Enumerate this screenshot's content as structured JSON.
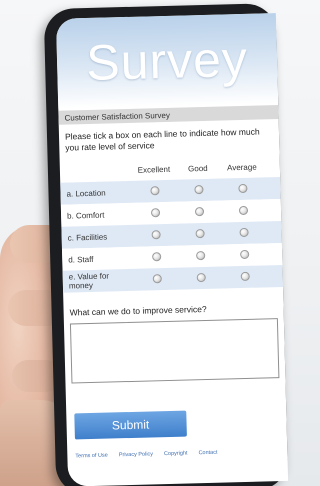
{
  "hero": {
    "title": "Survey"
  },
  "form": {
    "bar_title": "Customer Satisfaction Survey",
    "instruction": "Please tick a box on each line to indicate how much you rate level of service",
    "columns": [
      "Excellent",
      "Good",
      "Average"
    ],
    "rows": [
      {
        "label": "a. Location"
      },
      {
        "label": "b. Comfort"
      },
      {
        "label": "c. Facilities"
      },
      {
        "label": "d. Staff"
      },
      {
        "label": "e. Value for money"
      }
    ],
    "question": "What can we do to improve service?",
    "submit_label": "Submit"
  },
  "footer": {
    "links": [
      "Terms of Use",
      "Privacy Policy",
      "Copyright",
      "Contact"
    ]
  },
  "colors": {
    "accent": "#3f7fcb",
    "row_alt": "#dfe9f5",
    "hero_top": "#b9d1ea"
  }
}
